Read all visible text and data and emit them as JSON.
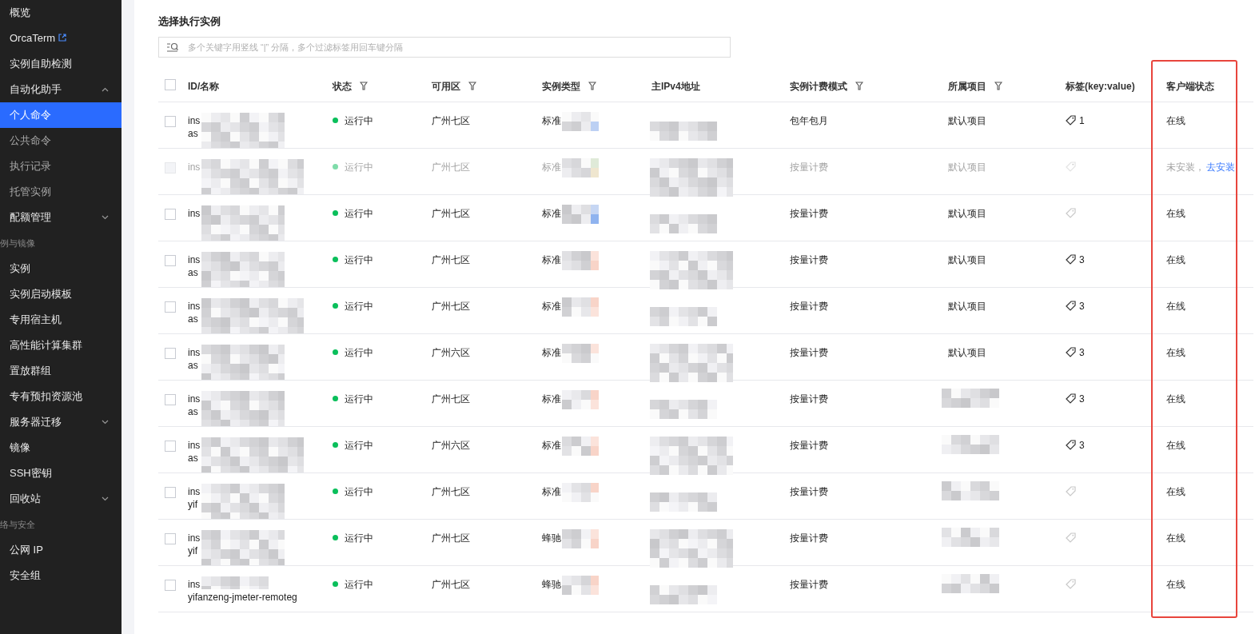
{
  "sidebar": {
    "items": [
      {
        "kind": "item",
        "label": "概览",
        "selected": false
      },
      {
        "kind": "item",
        "label": "OrcaTerm",
        "selected": false,
        "external": true
      },
      {
        "kind": "item",
        "label": "实例自助检测",
        "selected": false
      },
      {
        "kind": "item",
        "label": "自动化助手",
        "selected": false,
        "expanded": true
      },
      {
        "kind": "sub",
        "label": "个人命令",
        "selected": true
      },
      {
        "kind": "sub",
        "label": "公共命令",
        "selected": false
      },
      {
        "kind": "sub",
        "label": "执行记录",
        "selected": false
      },
      {
        "kind": "sub",
        "label": "托管实例",
        "selected": false
      },
      {
        "kind": "item",
        "label": "配额管理",
        "selected": false,
        "expanded": false
      },
      {
        "kind": "section",
        "label": "例与镜像"
      },
      {
        "kind": "item",
        "label": "实例",
        "selected": false
      },
      {
        "kind": "item",
        "label": "实例启动模板",
        "selected": false
      },
      {
        "kind": "item",
        "label": "专用宿主机",
        "selected": false
      },
      {
        "kind": "item",
        "label": "高性能计算集群",
        "selected": false
      },
      {
        "kind": "item",
        "label": "置放群组",
        "selected": false
      },
      {
        "kind": "item",
        "label": "专有预扣资源池",
        "selected": false
      },
      {
        "kind": "item",
        "label": "服务器迁移",
        "selected": false,
        "expanded": false
      },
      {
        "kind": "item",
        "label": "镜像",
        "selected": false
      },
      {
        "kind": "item",
        "label": "SSH密钥",
        "selected": false
      },
      {
        "kind": "item",
        "label": "回收站",
        "selected": false,
        "expanded": false
      },
      {
        "kind": "section",
        "label": "络与安全"
      },
      {
        "kind": "item",
        "label": "公网 IP",
        "selected": false
      },
      {
        "kind": "item",
        "label": "安全组",
        "selected": false
      }
    ]
  },
  "panel": {
    "title": "选择执行实例",
    "search": {
      "placeholder": "多个关键字用竖线 “|” 分隔，多个过滤标签用回车键分隔"
    }
  },
  "table": {
    "select_all": {
      "checked": false
    },
    "columns": [
      {
        "label": "ID/名称",
        "filter": false,
        "highlighted": false
      },
      {
        "label": "状态",
        "filter": true,
        "highlighted": false
      },
      {
        "label": "可用区",
        "filter": true,
        "highlighted": false
      },
      {
        "label": "实例类型",
        "filter": true,
        "highlighted": false
      },
      {
        "label": "主IPv4地址",
        "filter": false,
        "highlighted": false
      },
      {
        "label": "实例计费模式",
        "filter": true,
        "highlighted": false
      },
      {
        "label": "所属项目",
        "filter": true,
        "highlighted": false
      },
      {
        "label": "标签(key:value)",
        "filter": false,
        "highlighted": false
      },
      {
        "label": "客户端状态",
        "filter": false,
        "highlighted": true
      }
    ],
    "rows": [
      {
        "disabled": false,
        "selected": false,
        "id": "ins",
        "name": "as",
        "status": "运行中",
        "zone": "广州七区",
        "type": "标准",
        "billing": "包年包月",
        "project": "默认项目",
        "tags": "1",
        "client": "在线"
      },
      {
        "disabled": true,
        "selected": false,
        "id": "ins",
        "status": "运行中",
        "zone": "广州七区",
        "type": "标准",
        "billing": "按量计费",
        "project": "默认项目",
        "client": "未安装，",
        "install_link": "去安装"
      },
      {
        "disabled": false,
        "selected": false,
        "id": "ins",
        "status": "运行中",
        "zone": "广州七区",
        "type": "标准",
        "billing": "按量计费",
        "project": "默认项目",
        "client": "在线"
      },
      {
        "disabled": false,
        "selected": false,
        "id": "ins",
        "name": "as",
        "status": "运行中",
        "zone": "广州七区",
        "type": "标准",
        "billing": "按量计费",
        "project": "默认项目",
        "tags": "3",
        "client": "在线"
      },
      {
        "disabled": false,
        "selected": false,
        "id": "ins",
        "name": "as",
        "status": "运行中",
        "zone": "广州七区",
        "type": "标准",
        "billing": "按量计费",
        "project": "默认项目",
        "tags": "3",
        "client": "在线"
      },
      {
        "disabled": false,
        "selected": false,
        "id": "ins",
        "name": "as",
        "status": "运行中",
        "zone": "广州六区",
        "type": "标准",
        "billing": "按量计费",
        "project": "默认项目",
        "tags": "3",
        "client": "在线"
      },
      {
        "disabled": false,
        "selected": false,
        "id": "ins",
        "name": "as",
        "status": "运行中",
        "zone": "广州七区",
        "type": "标准",
        "billing": "按量计费",
        "tags": "3",
        "client": "在线"
      },
      {
        "disabled": false,
        "selected": false,
        "id": "ins",
        "name": "as",
        "status": "运行中",
        "zone": "广州六区",
        "type": "标准",
        "billing": "按量计费",
        "tags": "3",
        "client": "在线"
      },
      {
        "disabled": false,
        "selected": false,
        "id": "ins",
        "name": "yif",
        "status": "运行中",
        "zone": "广州七区",
        "type": "标准",
        "billing": "按量计费",
        "client": "在线"
      },
      {
        "disabled": false,
        "selected": false,
        "id": "ins",
        "name": "yif",
        "status": "运行中",
        "zone": "广州七区",
        "type": "蜂驰",
        "billing": "按量计费",
        "client": "在线"
      },
      {
        "disabled": false,
        "selected": false,
        "id": "ins",
        "name": "yifanzeng-jmeter-remoteg",
        "status": "运行中",
        "zone": "广州七区",
        "type": "蜂驰",
        "billing": "按量计费",
        "client": "在线"
      }
    ]
  }
}
